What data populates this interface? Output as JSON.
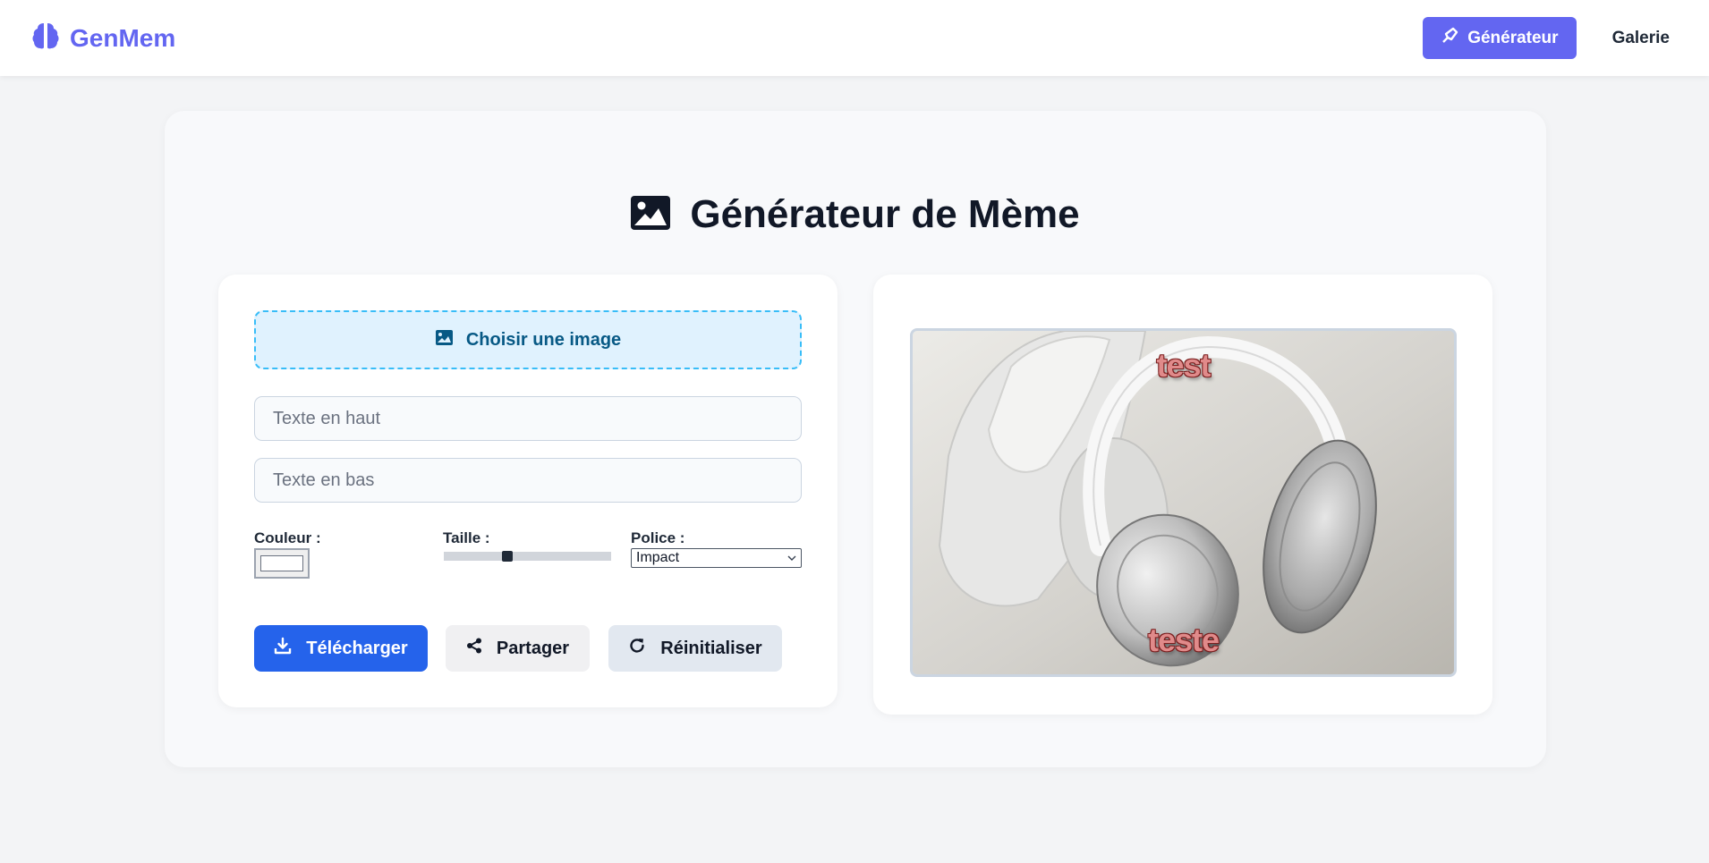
{
  "nav": {
    "brand": "GenMem",
    "generator_label": "Générateur",
    "gallery_label": "Galerie"
  },
  "page": {
    "title": "Générateur de Mème"
  },
  "editor": {
    "upload_label": "Choisir une image",
    "top_text": {
      "value": "",
      "placeholder": "Texte en haut"
    },
    "bottom_text": {
      "value": "",
      "placeholder": "Texte en bas"
    },
    "color_label": "Couleur :",
    "color_value": "#ffffff",
    "size_label": "Taille :",
    "size_level": 0.37,
    "font_label": "Police :",
    "font_selected": "Impact",
    "download_label": "Télécharger",
    "share_label": "Partager",
    "reset_label": "Réinitialiser"
  },
  "preview": {
    "top_text": "test",
    "bottom_text": "teste"
  },
  "colors": {
    "brand": "#6366f1",
    "primary": "#2563eb",
    "upload_bg": "#e0f2fe",
    "upload_border": "#38bdf8"
  }
}
